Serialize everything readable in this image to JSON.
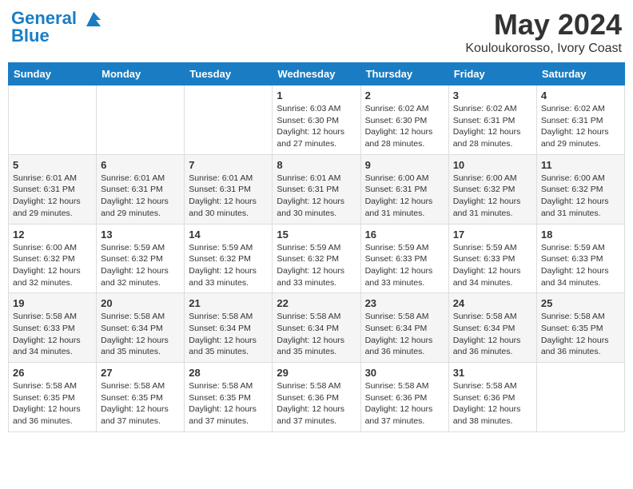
{
  "header": {
    "logo_line1": "General",
    "logo_line2": "Blue",
    "month_title": "May 2024",
    "location": "Kouloukorosso, Ivory Coast"
  },
  "weekdays": [
    "Sunday",
    "Monday",
    "Tuesday",
    "Wednesday",
    "Thursday",
    "Friday",
    "Saturday"
  ],
  "weeks": [
    [
      {
        "day": "",
        "info": ""
      },
      {
        "day": "",
        "info": ""
      },
      {
        "day": "",
        "info": ""
      },
      {
        "day": "1",
        "info": "Sunrise: 6:03 AM\nSunset: 6:30 PM\nDaylight: 12 hours\nand 27 minutes."
      },
      {
        "day": "2",
        "info": "Sunrise: 6:02 AM\nSunset: 6:30 PM\nDaylight: 12 hours\nand 28 minutes."
      },
      {
        "day": "3",
        "info": "Sunrise: 6:02 AM\nSunset: 6:31 PM\nDaylight: 12 hours\nand 28 minutes."
      },
      {
        "day": "4",
        "info": "Sunrise: 6:02 AM\nSunset: 6:31 PM\nDaylight: 12 hours\nand 29 minutes."
      }
    ],
    [
      {
        "day": "5",
        "info": "Sunrise: 6:01 AM\nSunset: 6:31 PM\nDaylight: 12 hours\nand 29 minutes."
      },
      {
        "day": "6",
        "info": "Sunrise: 6:01 AM\nSunset: 6:31 PM\nDaylight: 12 hours\nand 29 minutes."
      },
      {
        "day": "7",
        "info": "Sunrise: 6:01 AM\nSunset: 6:31 PM\nDaylight: 12 hours\nand 30 minutes."
      },
      {
        "day": "8",
        "info": "Sunrise: 6:01 AM\nSunset: 6:31 PM\nDaylight: 12 hours\nand 30 minutes."
      },
      {
        "day": "9",
        "info": "Sunrise: 6:00 AM\nSunset: 6:31 PM\nDaylight: 12 hours\nand 31 minutes."
      },
      {
        "day": "10",
        "info": "Sunrise: 6:00 AM\nSunset: 6:32 PM\nDaylight: 12 hours\nand 31 minutes."
      },
      {
        "day": "11",
        "info": "Sunrise: 6:00 AM\nSunset: 6:32 PM\nDaylight: 12 hours\nand 31 minutes."
      }
    ],
    [
      {
        "day": "12",
        "info": "Sunrise: 6:00 AM\nSunset: 6:32 PM\nDaylight: 12 hours\nand 32 minutes."
      },
      {
        "day": "13",
        "info": "Sunrise: 5:59 AM\nSunset: 6:32 PM\nDaylight: 12 hours\nand 32 minutes."
      },
      {
        "day": "14",
        "info": "Sunrise: 5:59 AM\nSunset: 6:32 PM\nDaylight: 12 hours\nand 33 minutes."
      },
      {
        "day": "15",
        "info": "Sunrise: 5:59 AM\nSunset: 6:32 PM\nDaylight: 12 hours\nand 33 minutes."
      },
      {
        "day": "16",
        "info": "Sunrise: 5:59 AM\nSunset: 6:33 PM\nDaylight: 12 hours\nand 33 minutes."
      },
      {
        "day": "17",
        "info": "Sunrise: 5:59 AM\nSunset: 6:33 PM\nDaylight: 12 hours\nand 34 minutes."
      },
      {
        "day": "18",
        "info": "Sunrise: 5:59 AM\nSunset: 6:33 PM\nDaylight: 12 hours\nand 34 minutes."
      }
    ],
    [
      {
        "day": "19",
        "info": "Sunrise: 5:58 AM\nSunset: 6:33 PM\nDaylight: 12 hours\nand 34 minutes."
      },
      {
        "day": "20",
        "info": "Sunrise: 5:58 AM\nSunset: 6:34 PM\nDaylight: 12 hours\nand 35 minutes."
      },
      {
        "day": "21",
        "info": "Sunrise: 5:58 AM\nSunset: 6:34 PM\nDaylight: 12 hours\nand 35 minutes."
      },
      {
        "day": "22",
        "info": "Sunrise: 5:58 AM\nSunset: 6:34 PM\nDaylight: 12 hours\nand 35 minutes."
      },
      {
        "day": "23",
        "info": "Sunrise: 5:58 AM\nSunset: 6:34 PM\nDaylight: 12 hours\nand 36 minutes."
      },
      {
        "day": "24",
        "info": "Sunrise: 5:58 AM\nSunset: 6:34 PM\nDaylight: 12 hours\nand 36 minutes."
      },
      {
        "day": "25",
        "info": "Sunrise: 5:58 AM\nSunset: 6:35 PM\nDaylight: 12 hours\nand 36 minutes."
      }
    ],
    [
      {
        "day": "26",
        "info": "Sunrise: 5:58 AM\nSunset: 6:35 PM\nDaylight: 12 hours\nand 36 minutes."
      },
      {
        "day": "27",
        "info": "Sunrise: 5:58 AM\nSunset: 6:35 PM\nDaylight: 12 hours\nand 37 minutes."
      },
      {
        "day": "28",
        "info": "Sunrise: 5:58 AM\nSunset: 6:35 PM\nDaylight: 12 hours\nand 37 minutes."
      },
      {
        "day": "29",
        "info": "Sunrise: 5:58 AM\nSunset: 6:36 PM\nDaylight: 12 hours\nand 37 minutes."
      },
      {
        "day": "30",
        "info": "Sunrise: 5:58 AM\nSunset: 6:36 PM\nDaylight: 12 hours\nand 37 minutes."
      },
      {
        "day": "31",
        "info": "Sunrise: 5:58 AM\nSunset: 6:36 PM\nDaylight: 12 hours\nand 38 minutes."
      },
      {
        "day": "",
        "info": ""
      }
    ]
  ]
}
